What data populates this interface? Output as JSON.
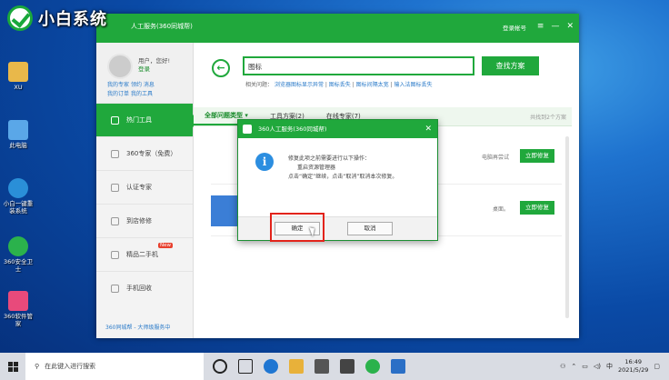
{
  "watermark": {
    "text": "小白系统"
  },
  "desktop_icons": [
    {
      "label": "XU",
      "icon": "user-folder-icon",
      "color": "#e9b84a"
    },
    {
      "label": "此电脑",
      "icon": "computer-icon",
      "color": "#5aa7e8"
    },
    {
      "label": "小白一键重装系统",
      "icon": "xiaobai-installer-icon",
      "color": "#2a8fd8"
    },
    {
      "label": "360安全卫士",
      "icon": "360-security-icon",
      "color": "#2bb24c"
    },
    {
      "label": "360软件管家",
      "icon": "360-software-icon",
      "color": "#e84a7b"
    }
  ],
  "window": {
    "title": "人工服务(360同城帮)",
    "login": "登录帐号",
    "controls": [
      "≡",
      "—",
      "✕"
    ]
  },
  "user": {
    "name": "用户，您好!",
    "login": "登录",
    "links": [
      "我的专家",
      "领约",
      "消息",
      "我的订单",
      "我的工具"
    ]
  },
  "sidebar": {
    "items": [
      {
        "label": "热门工具"
      },
      {
        "label": "360专家（免费）"
      },
      {
        "label": "认证专家"
      },
      {
        "label": "到店修修"
      },
      {
        "label": "精品二手机",
        "badge": "New"
      },
      {
        "label": "手机回收"
      }
    ],
    "footer": "360同城帮 - 大师级服务中"
  },
  "search": {
    "value": "图标",
    "button": "查找方案"
  },
  "related": {
    "label": "相关问题：",
    "links": [
      "浏览器图标显示异常",
      "图标丢失",
      "图标间隔太宽",
      "输入法图标丢失"
    ]
  },
  "tabs": {
    "items": [
      "全部问题类型",
      "工具方案(2)",
      "在线专家(7)"
    ],
    "summary": "共找到2个方案"
  },
  "results": [
    {
      "snippet": "电脑再尝试",
      "button": "立即修复"
    },
    {
      "snippet": "桌面。",
      "button": "立即修复"
    }
  ],
  "dialog": {
    "title": "360人工服务(360同城帮)",
    "lines": [
      "修复此项之前需要进行以下操作：",
      "重启资源管理器",
      "点击“确定”继续，点击“取消”取消本次修复。"
    ],
    "ok": "确定",
    "cancel": "取消"
  },
  "taskbar": {
    "search_placeholder": "在此键入进行搜索",
    "tray": {
      "ime": "中",
      "time": "16:49",
      "date": "2021/5/29"
    }
  }
}
